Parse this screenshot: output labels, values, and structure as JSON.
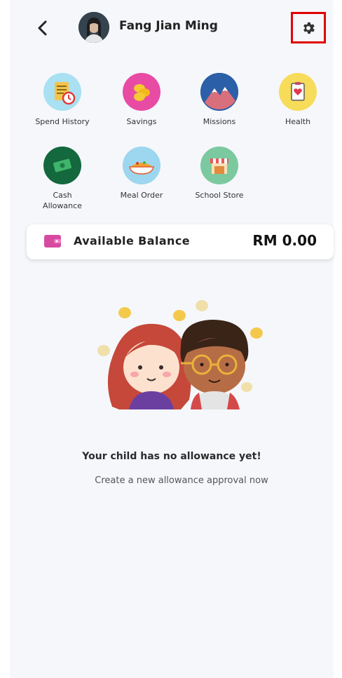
{
  "header": {
    "user_name": "Fang Jian Ming",
    "back_icon": "chevron-left-icon",
    "settings_icon": "gear-icon"
  },
  "menu": [
    {
      "label": "Spend History",
      "icon": "spend-history-icon",
      "color": "#a9e0f2"
    },
    {
      "label": "Savings",
      "icon": "savings-coins-icon",
      "color": "#e84ba3"
    },
    {
      "label": "Missions",
      "icon": "missions-mountain-icon",
      "color": "#2b5fa8"
    },
    {
      "label": "Health",
      "icon": "health-heart-icon",
      "color": "#f7dc59"
    },
    {
      "label": "Cash\nAllowance",
      "icon": "cash-allowance-icon",
      "color": "#14683d"
    },
    {
      "label": "Meal Order",
      "icon": "meal-order-icon",
      "color": "#9dd6ef"
    },
    {
      "label": "School Store",
      "icon": "school-store-icon",
      "color": "#7cc9a0"
    }
  ],
  "balance": {
    "label": "Available Balance",
    "value": "RM 0.00",
    "icon": "wallet-icon",
    "icon_color": "#d64aa0"
  },
  "empty_state": {
    "title": "Your child has no allowance yet!",
    "subtitle": "Create a new allowance approval now"
  },
  "colors": {
    "background": "#f5f7fb",
    "highlight": "#e00000"
  }
}
